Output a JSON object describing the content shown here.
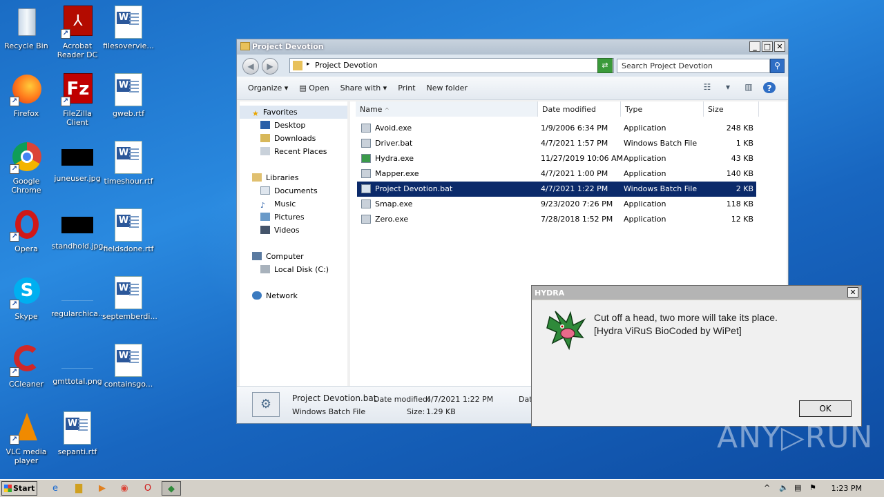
{
  "desktop": {
    "icons": [
      {
        "label": "Recycle Bin",
        "icon": "recycle-bin-icon"
      },
      {
        "label": "Acrobat Reader DC",
        "icon": "acrobat-icon"
      },
      {
        "label": "filesovervie...",
        "icon": "word-doc-icon"
      },
      {
        "label": "Firefox",
        "icon": "firefox-icon"
      },
      {
        "label": "FileZilla Client",
        "icon": "filezilla-icon"
      },
      {
        "label": "gweb.rtf",
        "icon": "word-doc-icon"
      },
      {
        "label": "Google Chrome",
        "icon": "chrome-icon"
      },
      {
        "label": "juneuser.jpg",
        "icon": "image-thumb-icon"
      },
      {
        "label": "timeshour.rtf",
        "icon": "word-doc-icon"
      },
      {
        "label": "Opera",
        "icon": "opera-icon"
      },
      {
        "label": "standhold.jpg",
        "icon": "image-thumb-icon"
      },
      {
        "label": "fieldsdone.rtf",
        "icon": "word-doc-icon"
      },
      {
        "label": "Skype",
        "icon": "skype-icon"
      },
      {
        "label": "regularchica...",
        "icon": "image-thumb-icon"
      },
      {
        "label": "septemberdi...",
        "icon": "word-doc-icon"
      },
      {
        "label": "CCleaner",
        "icon": "ccleaner-icon"
      },
      {
        "label": "gmttotal.png",
        "icon": "image-thumb-icon"
      },
      {
        "label": "containsgo...",
        "icon": "word-doc-icon"
      },
      {
        "label": "VLC media player",
        "icon": "vlc-icon"
      },
      {
        "label": "sepanti.rtf",
        "icon": "word-doc-icon"
      }
    ]
  },
  "explorer": {
    "title": "Project Devotion",
    "address": "Project Devotion",
    "search_placeholder": "Search Project Devotion",
    "toolbar": {
      "organize": "Organize",
      "open": "Open",
      "share_with": "Share with",
      "print": "Print",
      "new_folder": "New folder"
    },
    "nav": {
      "favorites": "Favorites",
      "desktop": "Desktop",
      "downloads": "Downloads",
      "recent_places": "Recent Places",
      "libraries": "Libraries",
      "documents": "Documents",
      "music": "Music",
      "pictures": "Pictures",
      "videos": "Videos",
      "computer": "Computer",
      "local_disk": "Local Disk (C:)",
      "network": "Network"
    },
    "columns": {
      "name": "Name",
      "date_modified": "Date modified",
      "type": "Type",
      "size": "Size"
    },
    "files": [
      {
        "name": "Avoid.exe",
        "date": "1/9/2006 6:34 PM",
        "type": "Application",
        "size": "248 KB"
      },
      {
        "name": "Driver.bat",
        "date": "4/7/2021 1:57 PM",
        "type": "Windows Batch File",
        "size": "1 KB"
      },
      {
        "name": "Hydra.exe",
        "date": "11/27/2019 10:06 AM",
        "type": "Application",
        "size": "43 KB"
      },
      {
        "name": "Mapper.exe",
        "date": "4/7/2021 1:00 PM",
        "type": "Application",
        "size": "140 KB"
      },
      {
        "name": "Project Devotion.bat",
        "date": "4/7/2021 1:22 PM",
        "type": "Windows Batch File",
        "size": "2 KB"
      },
      {
        "name": "Smap.exe",
        "date": "9/23/2020 7:26 PM",
        "type": "Application",
        "size": "118 KB"
      },
      {
        "name": "Zero.exe",
        "date": "7/28/2018 1:52 PM",
        "type": "Application",
        "size": "12 KB"
      }
    ],
    "details": {
      "filename": "Project Devotion.bat",
      "date_label": "Date modified:",
      "date_value": "4/7/2021 1:22 PM",
      "type": "Windows Batch File",
      "size_label": "Size:",
      "size_value": "1.29 KB",
      "extra": "Dat"
    }
  },
  "dialog": {
    "title": "HYDRA",
    "line1": "Cut off a head, two more will take its place.",
    "line2": "[Hydra ViRuS BioCoded by WiPet]",
    "ok": "OK"
  },
  "watermark": "ANY▷RUN",
  "taskbar": {
    "start": "Start",
    "clock": "1:23 PM"
  }
}
